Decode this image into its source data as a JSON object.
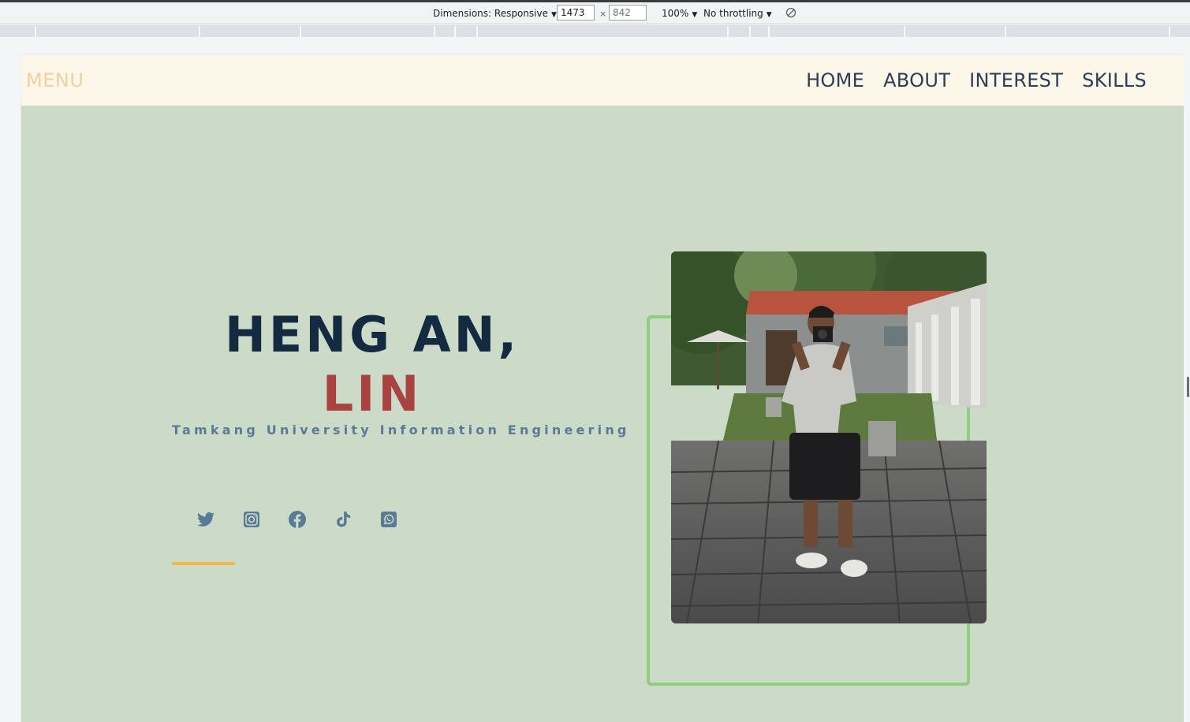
{
  "devtools": {
    "dimensions_label": "Dimensions: Responsive",
    "width_value": "1473",
    "height_placeholder": "842",
    "times": "×",
    "zoom": "100%",
    "throttling": "No throttling"
  },
  "nav": {
    "menu_label": "MENU",
    "links": [
      {
        "label": "HOME"
      },
      {
        "label": "ABOUT"
      },
      {
        "label": "INTEREST"
      },
      {
        "label": "SKILLS"
      }
    ]
  },
  "hero": {
    "name_line1": "HENG AN,",
    "name_line2": "LIN",
    "subtitle": "Tamkang University Information Engineering",
    "socials": [
      {
        "icon": "twitter-icon"
      },
      {
        "icon": "instagram-icon"
      },
      {
        "icon": "facebook-icon"
      },
      {
        "icon": "tiktok-icon"
      },
      {
        "icon": "whatsapp-icon"
      }
    ],
    "photo_icon": "profile-photo"
  },
  "colors": {
    "page_bg": "#cbdbc8",
    "navbar_bg": "#fdf7ea",
    "menu": "#f0cfa1",
    "nav_link": "#2c3e55",
    "name_primary": "#132a40",
    "name_accent": "#a84342",
    "subtitle": "#5a7b96",
    "accent_line": "#f1b94a",
    "frame": "#8fce7e"
  }
}
